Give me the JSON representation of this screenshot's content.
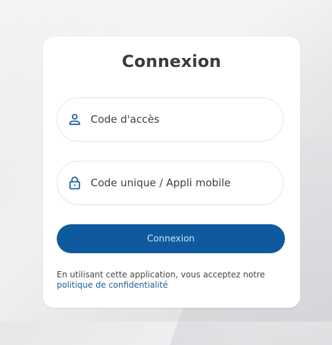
{
  "login": {
    "title": "Connexion",
    "access_code_placeholder": "Code d'accès",
    "unique_code_placeholder": "Code unique / Appli mobile",
    "submit_label": "Connexion",
    "legal_text": "En utilisant cette application, vous acceptez notre",
    "privacy_link_label": "politique de confidentialité"
  },
  "icons": {
    "access_code": "user-icon",
    "unique_code": "lock-icon"
  },
  "colors": {
    "primary": "#0f5a9e",
    "icon": "#1b5f9e",
    "link": "#1b5f9e",
    "title": "#3a3a3a"
  }
}
